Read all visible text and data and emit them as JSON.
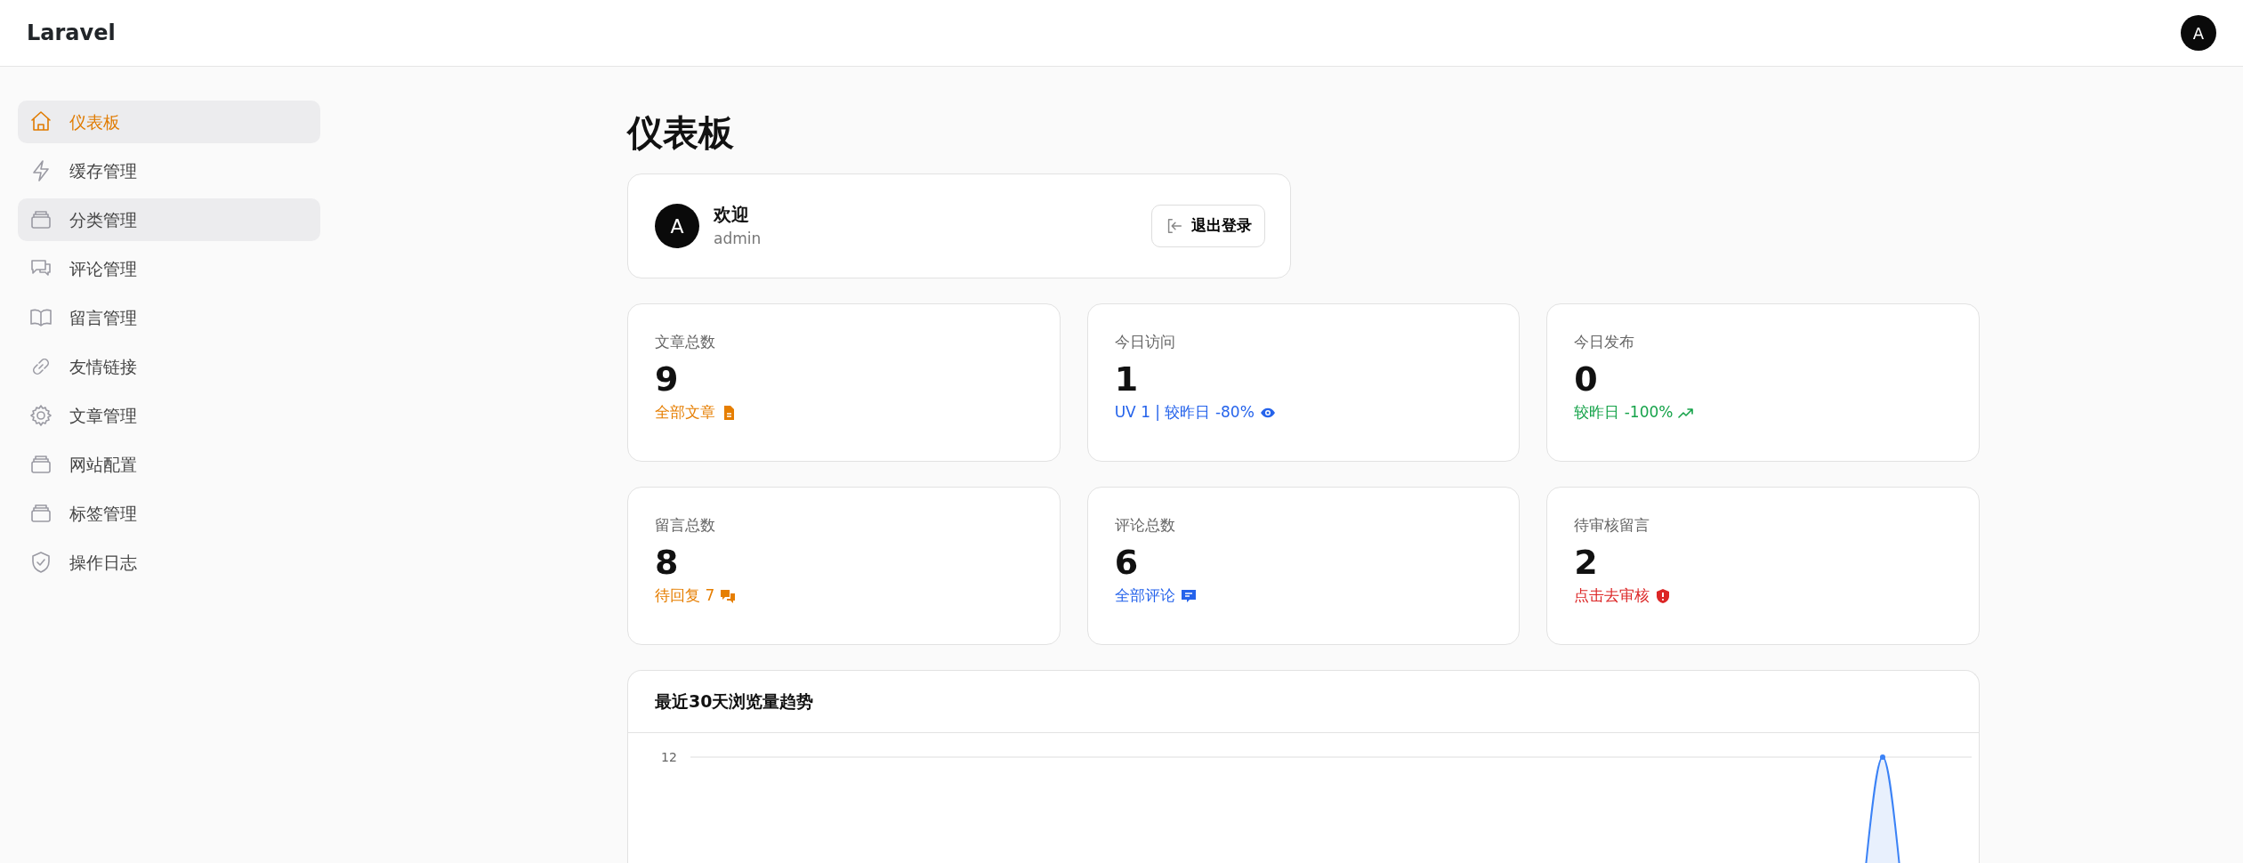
{
  "navbar": {
    "brand": "Laravel",
    "avatar": "A"
  },
  "sidebar": {
    "items": [
      {
        "label": "仪表板",
        "selected": true,
        "hovered": true
      },
      {
        "label": "缓存管理",
        "selected": false,
        "hovered": false
      },
      {
        "label": "分类管理",
        "selected": false,
        "hovered": true
      },
      {
        "label": "评论管理",
        "selected": false,
        "hovered": false
      },
      {
        "label": "留言管理",
        "selected": false,
        "hovered": false
      },
      {
        "label": "友情链接",
        "selected": false,
        "hovered": false
      },
      {
        "label": "文章管理",
        "selected": false,
        "hovered": false
      },
      {
        "label": "网站配置",
        "selected": false,
        "hovered": false
      },
      {
        "label": "标签管理",
        "selected": false,
        "hovered": false
      },
      {
        "label": "操作日志",
        "selected": false,
        "hovered": false
      }
    ]
  },
  "page_title": "仪表板",
  "welcome": {
    "avatar": "A",
    "greeting": "欢迎",
    "username": "admin",
    "logout_button": "退出登录"
  },
  "stats": [
    {
      "title": "文章总数",
      "value": "9",
      "footer": "全部文章",
      "color": "#e67e00"
    },
    {
      "title": "今日访问",
      "value": "1",
      "footer": "UV 1 | 较昨日 -80%",
      "color": "#2563eb"
    },
    {
      "title": "今日发布",
      "value": "0",
      "footer": "较昨日 -100%",
      "color": "#16a34a"
    },
    {
      "title": "留言总数",
      "value": "8",
      "footer": "待回复 7",
      "color": "#e67e00"
    },
    {
      "title": "评论总数",
      "value": "6",
      "footer": "全部评论",
      "color": "#2563eb"
    },
    {
      "title": "待审核留言",
      "value": "2",
      "footer": "点击去审核",
      "color": "#dc2626"
    }
  ],
  "chart": {
    "title": "最近30天浏览量趋势",
    "y_tick_label": "12"
  }
}
